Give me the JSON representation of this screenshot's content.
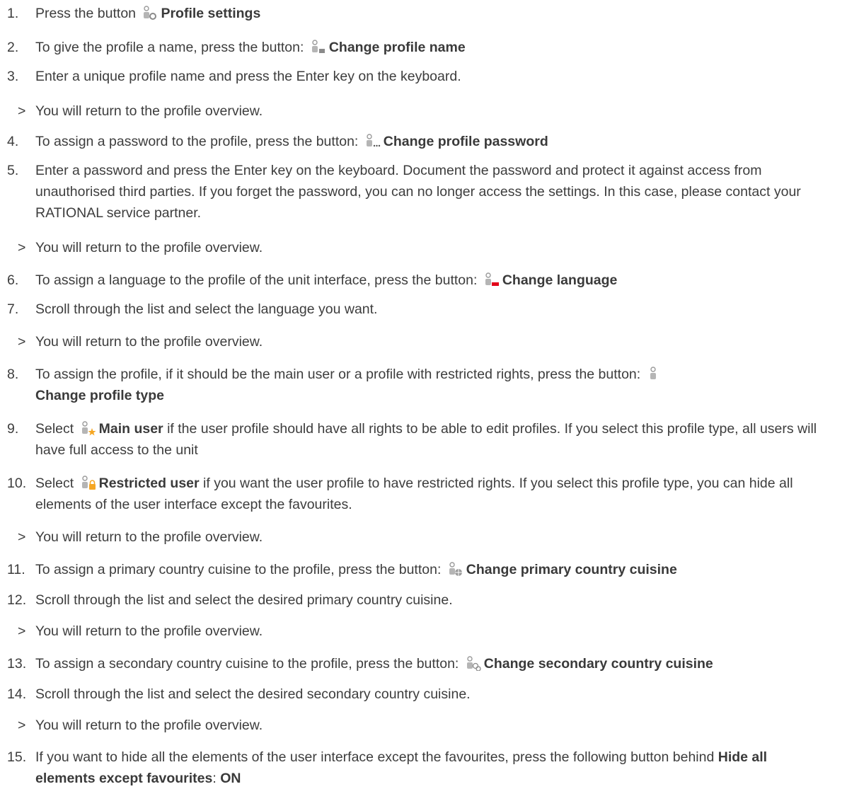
{
  "steps": [
    {
      "num": "1.",
      "pre": "Press the button",
      "icon": "profile-settings-icon",
      "bold": "Profile settings",
      "post": ""
    },
    {
      "num": "2.",
      "pre": "To give the profile a name, press the button:",
      "icon": "change-profile-name-icon",
      "bold": "Change profile name",
      "post": ""
    },
    {
      "num": "3.",
      "pre": "Enter a unique profile name and press the Enter key on the keyboard.",
      "icon": "",
      "bold": "",
      "post": ""
    },
    {
      "num": ">",
      "pre": "You will return to the profile overview.",
      "icon": "",
      "bold": "",
      "post": ""
    },
    {
      "num": "4.",
      "pre": "To assign a password to the profile, press the button:",
      "icon": "change-profile-password-icon",
      "bold": "Change profile password",
      "post": ""
    },
    {
      "num": "5.",
      "pre": "Enter a password and press the Enter key on the keyboard. Document the password and protect it against access from unauthorised third parties. If you forget the password, you can no longer access the settings. In this case, please contact your RATIONAL service partner.",
      "icon": "",
      "bold": "",
      "post": ""
    },
    {
      "num": ">",
      "pre": "You will return to the profile overview.",
      "icon": "",
      "bold": "",
      "post": ""
    },
    {
      "num": "6.",
      "pre": "To assign a language to the profile of the unit interface, press the button:",
      "icon": "change-language-icon",
      "bold": "Change language",
      "post": ""
    },
    {
      "num": "7.",
      "pre": "Scroll through the list and select the language you want.",
      "icon": "",
      "bold": "",
      "post": ""
    },
    {
      "num": ">",
      "pre": "You will return to the profile overview.",
      "icon": "",
      "bold": "",
      "post": ""
    },
    {
      "num": "8.",
      "pre": "To assign the profile, if it should be the main user or a profile with restricted rights, press the button:",
      "icon": "change-profile-type-icon",
      "bold": "Change profile type",
      "post": ""
    },
    {
      "num": "9.",
      "pre": "Select",
      "icon": "main-user-icon",
      "bold": "Main user",
      "post": "if the user profile should have all rights to be able to edit profiles. If you select this profile type, all users will have full access to the unit"
    },
    {
      "num": "10.",
      "pre": "Select",
      "icon": "restricted-user-icon",
      "bold": "Restricted user",
      "post": "if you want the user profile to have restricted rights. If you select this profile type, you can hide all elements of the user interface except the favourites."
    },
    {
      "num": ">",
      "pre": "You will return to the profile overview.",
      "icon": "",
      "bold": "",
      "post": ""
    },
    {
      "num": "11.",
      "pre": "To assign a primary country cuisine to the profile, press the button:",
      "icon": "change-primary-cuisine-icon",
      "bold": "Change primary country cuisine",
      "post": ""
    },
    {
      "num": "12.",
      "pre": "Scroll through the list and select the desired primary country cuisine.",
      "icon": "",
      "bold": "",
      "post": ""
    },
    {
      "num": ">",
      "pre": "You will return to the profile overview.",
      "icon": "",
      "bold": "",
      "post": ""
    },
    {
      "num": "13.",
      "pre": "To assign a secondary country cuisine to the profile, press the button:",
      "icon": "change-secondary-cuisine-icon",
      "bold": "Change secondary country cuisine",
      "post": ""
    },
    {
      "num": "14.",
      "pre": "Scroll through the list and select the desired secondary country cuisine.",
      "icon": "",
      "bold": "",
      "post": ""
    },
    {
      "num": ">",
      "pre": "You will return to the profile overview.",
      "icon": "",
      "bold": "",
      "post": ""
    },
    {
      "num": "15.",
      "pre": "If you want to hide all the elements of the user interface except the favourites, press the following button behind",
      "icon": "",
      "bold": "Hide all elements except favourites",
      "post": ":",
      "bold2": "ON"
    }
  ],
  "colors": {
    "text": "#3d3d3d",
    "icon_gray": "#9a9a9a",
    "icon_accent_red": "#e2001a",
    "icon_accent_orange": "#f5a623"
  }
}
